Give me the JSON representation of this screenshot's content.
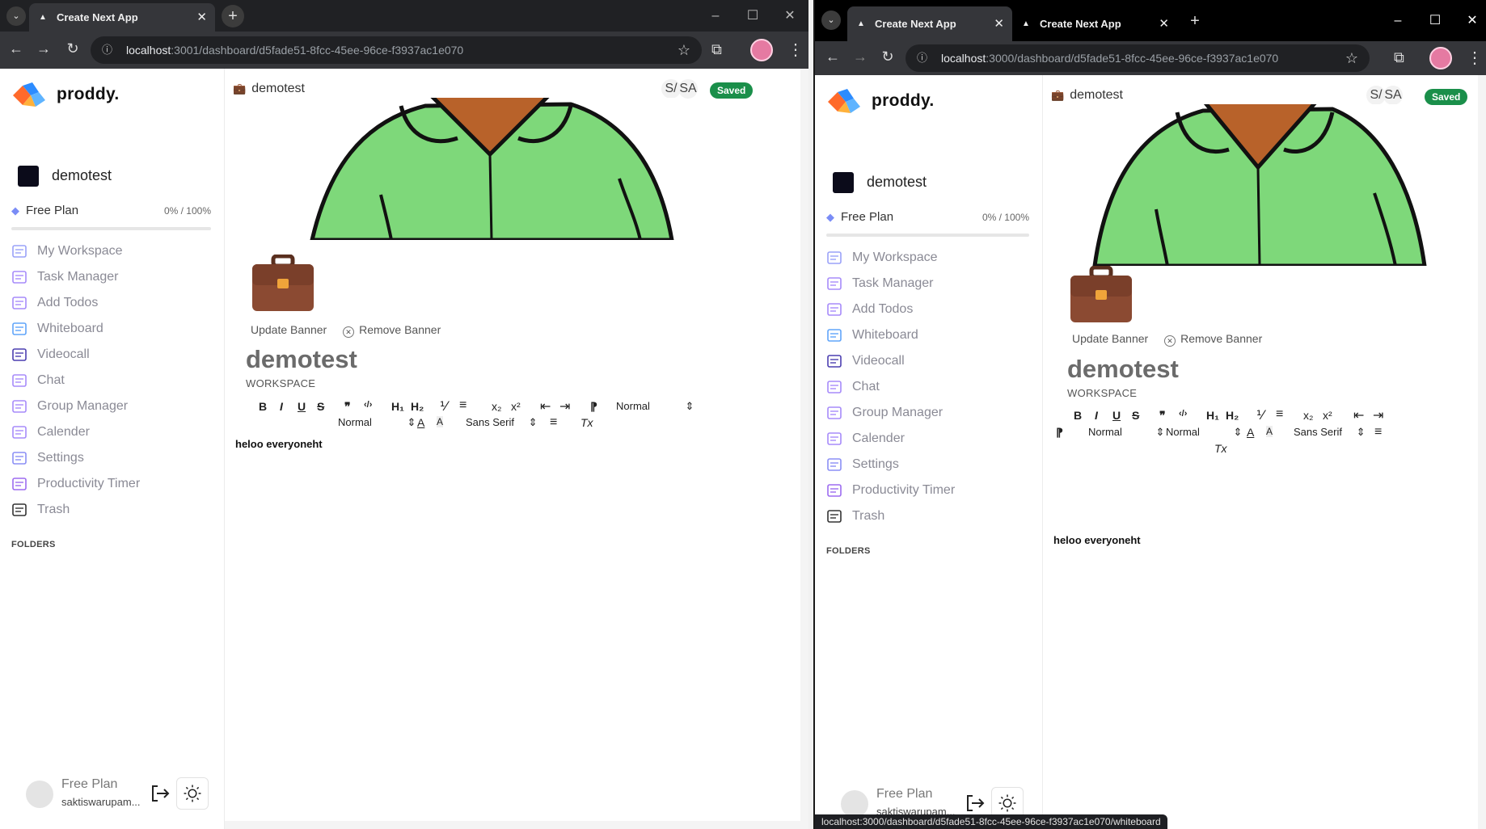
{
  "left": {
    "tab": {
      "title": "Create Next App",
      "new_tab": "+"
    },
    "url": {
      "host": "localhost",
      "path": ":3001/dashboard/d5fade51-8fcc-45ee-96ce-f3937ac1e070"
    },
    "sidebar": {
      "brand": "proddy.",
      "workspace_name": "demotest",
      "plan_label": "Free Plan",
      "plan_usage": "0% / 100%",
      "nav": [
        "My Workspace",
        "Task Manager",
        "Add Todos",
        "Whiteboard",
        "Videocall",
        "Chat",
        "Group Manager",
        "Calender",
        "Settings",
        "Productivity Timer",
        "Trash"
      ],
      "folders_label": "FOLDERS",
      "user_plan": "Free Plan",
      "user_email": "saktiswarupam..."
    },
    "main": {
      "breadcrumb": "demotest",
      "presence": [
        "S/",
        "SA"
      ],
      "saved": "Saved",
      "update_banner": "Update Banner",
      "remove_banner": "Remove Banner",
      "title": "demotest",
      "subtitle": "WORKSPACE",
      "toolbar": {
        "bold": "B",
        "italic": "I",
        "underline": "U",
        "strike": "S",
        "quote": "❞",
        "code": "‹/›",
        "h1": "H₁",
        "h2": "H₂",
        "ol": "⅟",
        "ul": "≡",
        "sub": "x₂",
        "sup": "x²",
        "outdent": "⇤",
        "indent": "⇥",
        "rtl": "⁋",
        "header_select": "Normal",
        "size_select": "Normal",
        "font_select": "Sans Serif",
        "color": "A",
        "background": "A",
        "align": "≡",
        "clean": "Tx"
      },
      "body_text": "heloo everyoneht"
    }
  },
  "right": {
    "tabs": [
      {
        "title": "Create Next App"
      },
      {
        "title": "Create Next App"
      }
    ],
    "new_tab": "+",
    "url": {
      "host": "localhost",
      "path": ":3000/dashboard/d5fade51-8fcc-45ee-96ce-f3937ac1e070"
    },
    "sidebar": {
      "brand": "proddy.",
      "workspace_name": "demotest",
      "plan_label": "Free Plan",
      "plan_usage": "0% / 100%",
      "nav": [
        "My Workspace",
        "Task Manager",
        "Add Todos",
        "Whiteboard",
        "Videocall",
        "Chat",
        "Group Manager",
        "Calender",
        "Settings",
        "Productivity Timer",
        "Trash"
      ],
      "folders_label": "FOLDERS",
      "user_plan": "Free Plan",
      "user_email": "saktiswarupam..."
    },
    "main": {
      "breadcrumb": "demotest",
      "presence": [
        "S/",
        "SA"
      ],
      "saved": "Saved",
      "update_banner": "Update Banner",
      "remove_banner": "Remove Banner",
      "title": "demotest",
      "subtitle": "WORKSPACE",
      "toolbar": {
        "bold": "B",
        "italic": "I",
        "underline": "U",
        "strike": "S",
        "quote": "❞",
        "code": "‹/›",
        "h1": "H₁",
        "h2": "H₂",
        "ol": "⅟",
        "ul": "≡",
        "sub": "x₂",
        "sup": "x²",
        "outdent": "⇤",
        "indent": "⇥",
        "rtl": "⁋",
        "header_select": "Normal",
        "size_select": "Normal",
        "font_select": "Sans Serif",
        "color": "A",
        "background": "A",
        "align": "≡",
        "clean": "Tx"
      },
      "body_text": "heloo everyoneht"
    },
    "status_url": "localhost:3000/dashboard/d5fade51-8fcc-45ee-96ce-f3937ac1e070/whiteboard"
  },
  "colors": {
    "saved": "#1a8f4a",
    "banner_green": "#7ed87a",
    "skin": "#b8622a",
    "briefcase": "#8b4a32",
    "nav_text": "#8a8a95"
  },
  "icons": [
    "chevron-down-icon",
    "back-arrow-icon",
    "forward-arrow-icon",
    "reload-icon",
    "info-icon",
    "star-icon",
    "extensions-icon",
    "kebab-icon",
    "minimize-icon",
    "maximize-icon",
    "close-icon",
    "briefcase-icon",
    "gem-icon",
    "logout-icon",
    "sun-icon"
  ]
}
